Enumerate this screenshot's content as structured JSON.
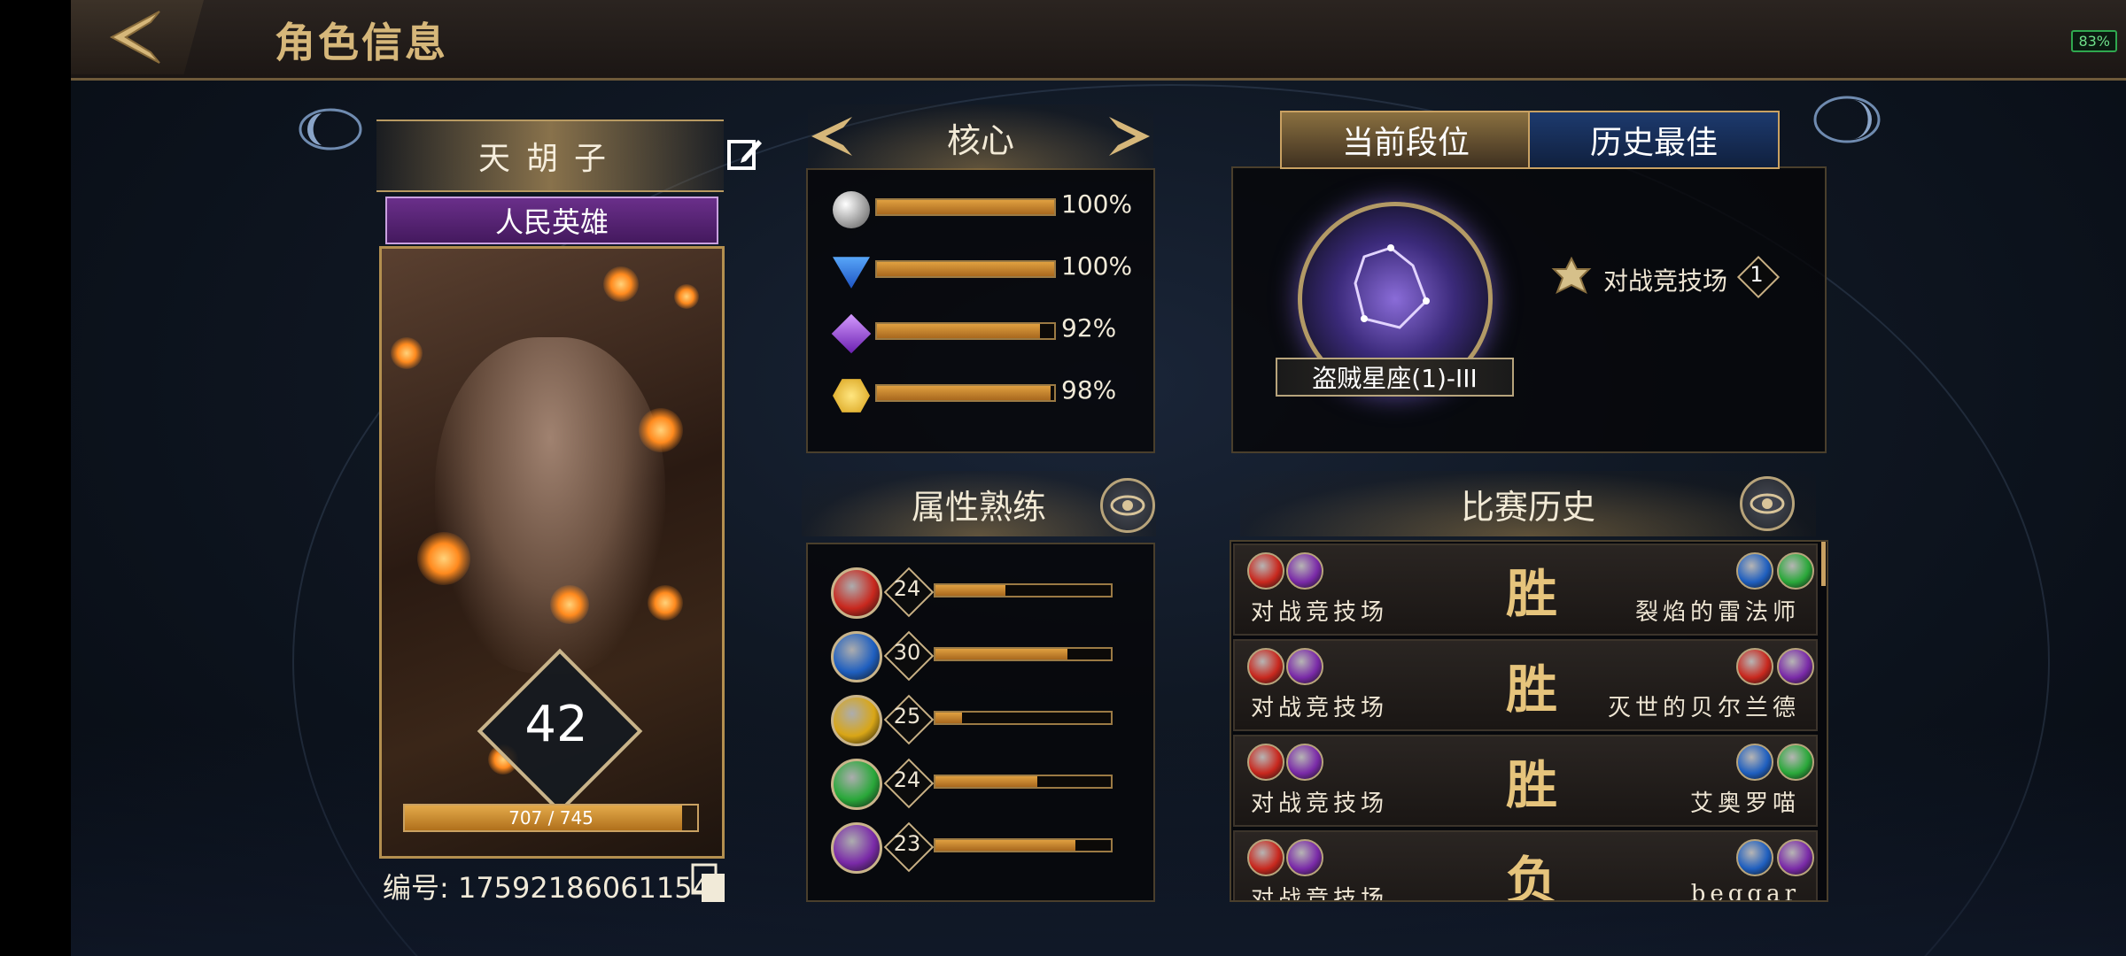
{
  "header": {
    "title": "角色信息",
    "battery": "83%"
  },
  "profile": {
    "name": "天胡子",
    "title": "人民英雄",
    "level": "42",
    "xp_text": "707 / 745",
    "xp_fraction": 0.949,
    "id_label": "编号: 17592186061154"
  },
  "core": {
    "title": "核心",
    "stats": [
      {
        "icon": "silver-orb-icon",
        "value": "100%",
        "fraction": 1.0
      },
      {
        "icon": "blue-triangle-icon",
        "value": "100%",
        "fraction": 1.0
      },
      {
        "icon": "purple-diamond-icon",
        "value": "92%",
        "fraction": 0.92
      },
      {
        "icon": "gold-hexagon-icon",
        "value": "98%",
        "fraction": 0.98
      }
    ]
  },
  "mastery": {
    "title": "属性熟练",
    "items": [
      {
        "icon": "red-fist-icon",
        "level": "24",
        "fraction": 0.4
      },
      {
        "icon": "blue-book-icon",
        "level": "30",
        "fraction": 0.75
      },
      {
        "icon": "gold-beast-icon",
        "level": "25",
        "fraction": 0.15
      },
      {
        "icon": "green-arrow-icon",
        "level": "24",
        "fraction": 0.58
      },
      {
        "icon": "purple-anvil-icon",
        "level": "23",
        "fraction": 0.8
      }
    ]
  },
  "rank": {
    "tabs": [
      "当前段位",
      "历史最佳"
    ],
    "rank_name": "盗贼星座(1)-III",
    "mode": "对战竞技场",
    "mode_count": "1"
  },
  "history": {
    "title": "比赛历史",
    "matches": [
      {
        "mode": "对战竞技场",
        "result": "胜",
        "opponent": "裂焰的雷法师",
        "opp_icons": [
          "#1f5fbf",
          "#2aa83a"
        ]
      },
      {
        "mode": "对战竞技场",
        "result": "胜",
        "opponent": "灭世的贝尔兰德",
        "opp_icons": [
          "#c8281e",
          "#7a2aa8"
        ]
      },
      {
        "mode": "对战竞技场",
        "result": "胜",
        "opponent": "艾奥罗喵",
        "opp_icons": [
          "#1f5fbf",
          "#2aa83a"
        ]
      },
      {
        "mode": "对战竞技场",
        "result": "负",
        "opponent": "beggar",
        "opp_icons": [
          "#1f5fbf",
          "#7a2aa8"
        ]
      }
    ]
  },
  "colors": {
    "gold": "#c9a162",
    "purple": "#6a2f8a",
    "red": "#c8281e",
    "blue": "#1f5fbf",
    "green": "#2aa83a"
  }
}
